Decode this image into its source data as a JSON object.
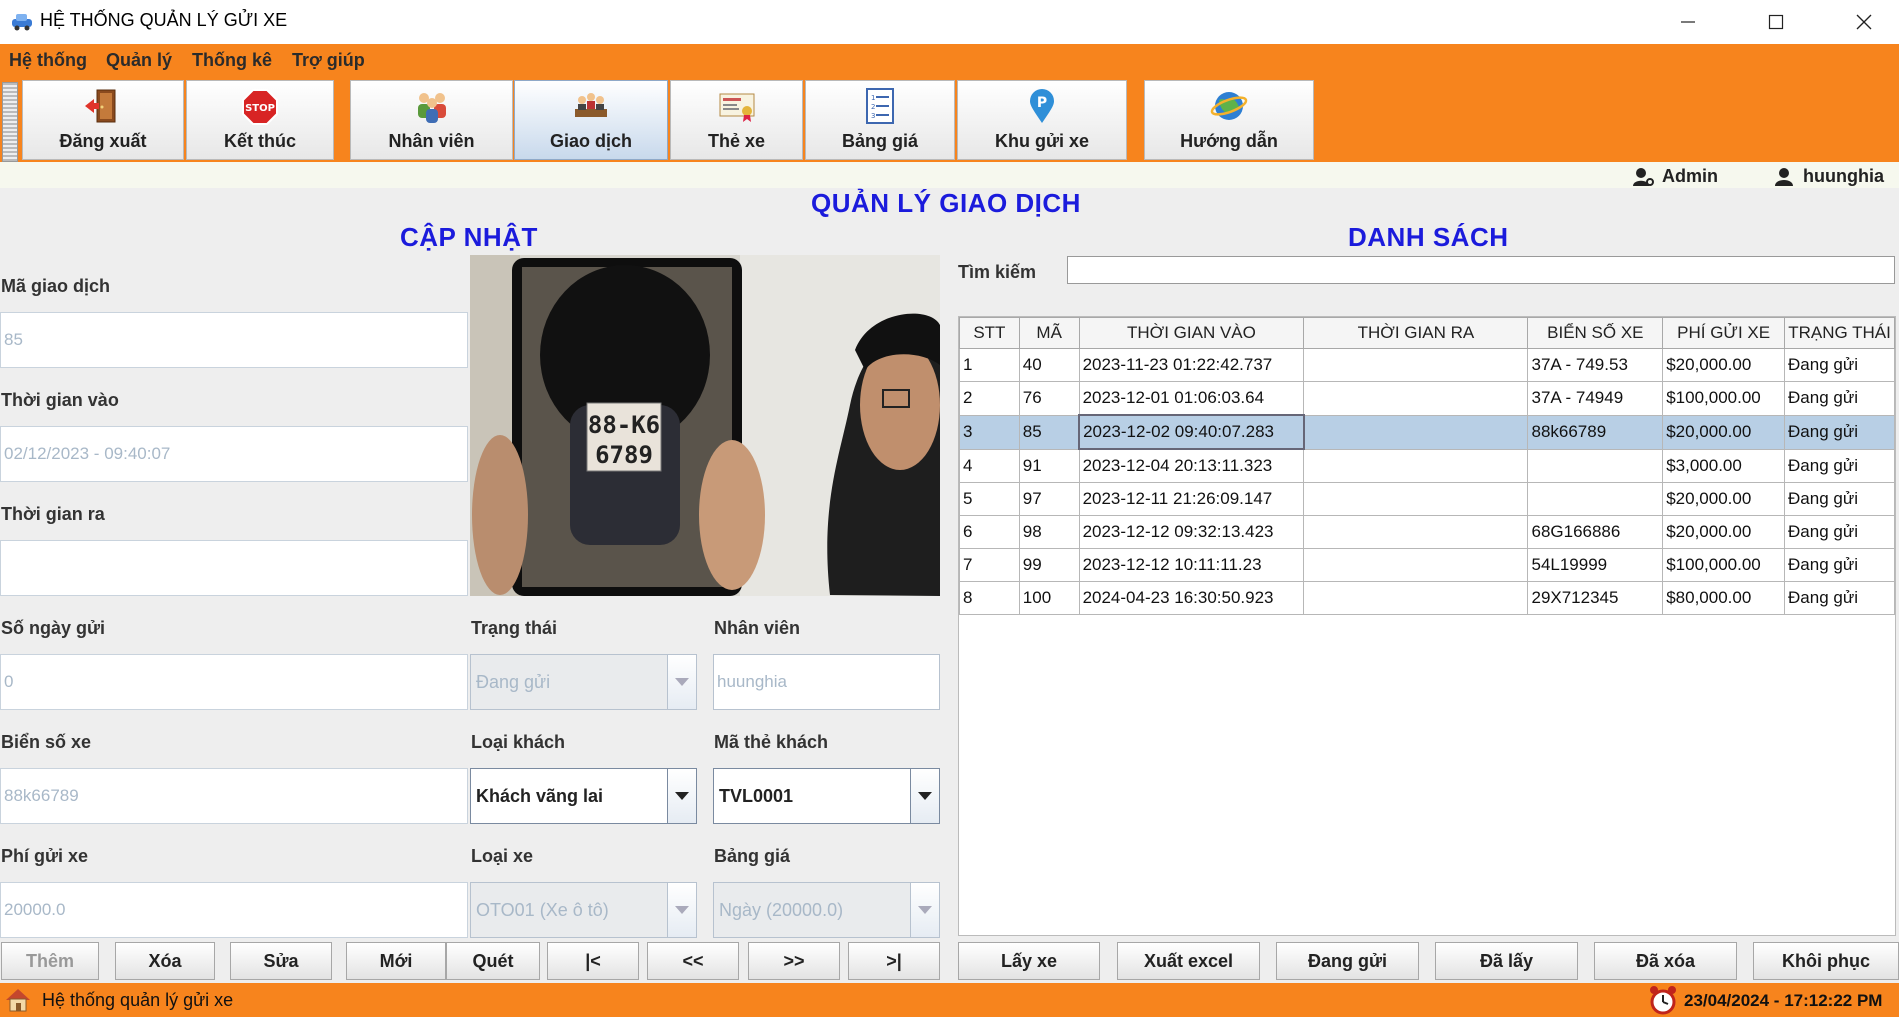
{
  "window": {
    "title": "HỆ THỐNG QUẢN LÝ GỬI XE",
    "minimize": "—",
    "maximize": "☐",
    "close": "✕"
  },
  "menu": [
    "Hệ thống",
    "Quản lý",
    "Thống kê",
    "Trợ giúp"
  ],
  "toolbar": [
    {
      "label": "Đăng xuất",
      "icon": "door-exit-icon"
    },
    {
      "label": "Kết thúc",
      "icon": "stop-sign-icon"
    },
    {
      "label": "Nhân viên",
      "icon": "staff-group-icon"
    },
    {
      "label": "Giao dịch",
      "icon": "meeting-icon",
      "active": true
    },
    {
      "label": "Thẻ xe",
      "icon": "card-icon"
    },
    {
      "label": "Bảng giá",
      "icon": "price-list-icon"
    },
    {
      "label": "Khu gửi xe",
      "icon": "parking-pin-icon"
    },
    {
      "label": "Hướng dẫn",
      "icon": "globe-help-icon"
    }
  ],
  "users": {
    "role": "Admin",
    "username": "huunghia"
  },
  "page_title": "QUẢN LÝ GIAO DỊCH",
  "form": {
    "heading": "CẬP NHẬT",
    "ma_giao_dich": {
      "label": "Mã giao dịch",
      "value": "85"
    },
    "thoi_gian_vao": {
      "label": "Thời gian vào",
      "value": "02/12/2023 - 09:40:07"
    },
    "thoi_gian_ra": {
      "label": "Thời gian ra",
      "value": ""
    },
    "so_ngay_gui": {
      "label": "Số ngày gửi",
      "value": "0"
    },
    "trang_thai": {
      "label": "Trạng thái",
      "value": "Đang gửi"
    },
    "nhan_vien": {
      "label": "Nhân viên",
      "value": "huunghia"
    },
    "bien_so_xe": {
      "label": "Biển số xe",
      "value": "88k66789"
    },
    "loai_khach": {
      "label": "Loại khách",
      "value": "Khách vãng lai"
    },
    "ma_the_khach": {
      "label": "Mã thẻ khách",
      "value": "TVL0001"
    },
    "phi_gui_xe": {
      "label": "Phí gửi xe",
      "value": "20000.0"
    },
    "loai_xe": {
      "label": "Loại xe",
      "value": "OTO01 (Xe ô tô)"
    },
    "bang_gia": {
      "label": "Bảng giá",
      "value": "Ngày (20000.0)"
    },
    "plate_photo": {
      "plate_line1": "88-K6",
      "plate_line2": "6789"
    }
  },
  "list": {
    "heading": "DANH SÁCH",
    "search_label": "Tìm kiếm",
    "search_value": "",
    "columns": [
      "STT",
      "MÃ",
      "THỜI GIAN VÀO",
      "THỜI GIAN RA",
      "BIỂN SỐ XE",
      "PHÍ GỬI XE",
      "TRẠNG THÁI"
    ],
    "rows": [
      [
        "1",
        "40",
        "2023-11-23 01:22:42.737",
        "",
        "37A - 749.53",
        "$20,000.00",
        "Đang gửi"
      ],
      [
        "2",
        "76",
        "2023-12-01 01:06:03.64",
        "",
        "37A - 74949",
        "$100,000.00",
        "Đang gửi"
      ],
      [
        "3",
        "85",
        "2023-12-02 09:40:07.283",
        "",
        "88k66789",
        "$20,000.00",
        "Đang gửi"
      ],
      [
        "4",
        "91",
        "2023-12-04 20:13:11.323",
        "",
        "",
        "$3,000.00",
        "Đang gửi"
      ],
      [
        "5",
        "97",
        "2023-12-11 21:26:09.147",
        "",
        "",
        "$20,000.00",
        "Đang gửi"
      ],
      [
        "6",
        "98",
        "2023-12-12 09:32:13.423",
        "",
        "68G166886",
        "$20,000.00",
        "Đang gửi"
      ],
      [
        "7",
        "99",
        "2023-12-12 10:11:11.23",
        "",
        "54L19999",
        "$100,000.00",
        "Đang gửi"
      ],
      [
        "8",
        "100",
        "2024-04-23 16:30:50.923",
        "",
        "29X712345",
        "$80,000.00",
        "Đang gửi"
      ]
    ],
    "selected_row": 2
  },
  "form_buttons": [
    "Thêm",
    "Xóa",
    "Sửa",
    "Mới",
    "Quét",
    "|<",
    "<<",
    ">>",
    ">|"
  ],
  "list_buttons": [
    "Lấy xe",
    "Xuất excel",
    "Đang gửi",
    "Đã lấy",
    "Đã xóa",
    "Khôi phục"
  ],
  "status": {
    "app_name": "Hệ thống quản lý gửi xe",
    "datetime": "23/04/2024 - 17:12:22 PM"
  },
  "colors": {
    "accent_orange": "#f7841d",
    "heading_blue": "#1b1bdc",
    "selection": "#b8cfe5"
  }
}
